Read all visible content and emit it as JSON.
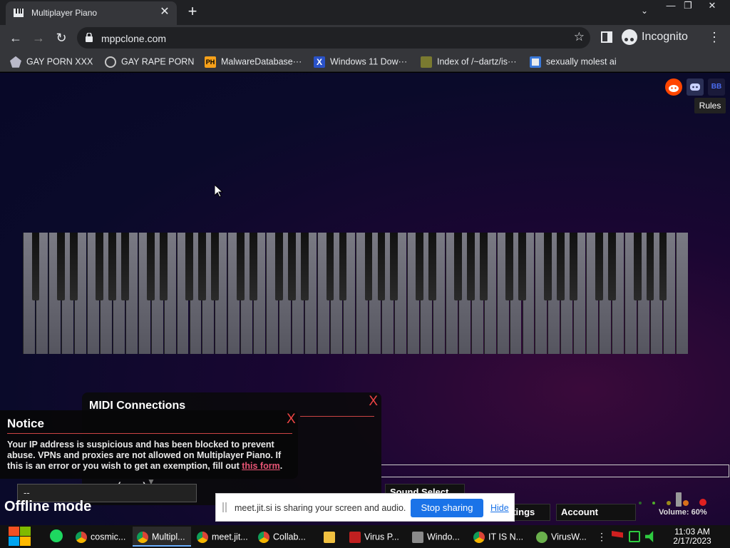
{
  "browser": {
    "tab_title": "Multiplayer Piano",
    "tab_close": "✕",
    "new_tab": "+",
    "tab_search": "⌄",
    "url": "mppclone.com",
    "incognito_label": "Incognito",
    "window": {
      "minimize": "—",
      "restore": "❐",
      "close": "✕"
    },
    "nav": {
      "back": "←",
      "forward": "→",
      "reload": "↻",
      "star": "☆",
      "menu": "⋮"
    }
  },
  "bookmarks": [
    {
      "label": "GAY PORN XXX",
      "icon": "obsidian-icon"
    },
    {
      "label": "GAY RAPE PORN",
      "icon": "globe-icon"
    },
    {
      "label": "MalwareDatabase···",
      "icon": "ph-icon"
    },
    {
      "label": "Windows 11 Dow···",
      "icon": "x-icon"
    },
    {
      "label": "Index of /~dartz/is···",
      "icon": "folder-icon"
    },
    {
      "label": "sexually molest ai",
      "icon": "bot-icon"
    }
  ],
  "page": {
    "rules_label": "Rules",
    "social_icons": [
      "reddit-icon",
      "discord-icon",
      "bb-icon"
    ],
    "bb_label": "BB",
    "midi": {
      "title": "MIDI Connections",
      "close": "X",
      "selected": "(none)",
      "arrow": "▼"
    },
    "notice": {
      "title": "Notice",
      "close": "X",
      "body": "Your IP address is suspicious and has been blocked to prevent abuse. VPNs and proxies are not allowed on Multiplayer Piano. If this is an error or you wish to get an exemption, fill out ",
      "link_text": "this form",
      "body_end": "."
    },
    "room_select": "--",
    "offline_label": "Offline mode",
    "sound_select_label": "Sound Select",
    "settings_label": "Settings",
    "account_label": "Account",
    "volume_label": "Volume: 60%",
    "volume": 0.6,
    "piano": {
      "white_keys": 52
    }
  },
  "share_bar": {
    "text": "meet.jit.si is sharing your screen and audio.",
    "stop_label": "Stop sharing",
    "hide_label": "Hide"
  },
  "taskbar": {
    "items": [
      {
        "label": "cosmic...",
        "icon": "chrome-icon",
        "active": false
      },
      {
        "label": "Multipl...",
        "icon": "chrome-icon",
        "active": true
      },
      {
        "label": "meet.jit...",
        "icon": "chrome-icon",
        "active": false
      },
      {
        "label": "Collab...",
        "icon": "chrome-icon",
        "active": false
      },
      {
        "label": "",
        "icon": "file-explorer-icon",
        "active": false
      },
      {
        "label": "Virus P...",
        "icon": "virus-icon",
        "active": false
      },
      {
        "label": "Windo...",
        "icon": "window-icon",
        "active": false
      },
      {
        "label": "IT IS N...",
        "icon": "chrome-icon",
        "active": false
      },
      {
        "label": "VirusW...",
        "icon": "virusw-icon",
        "active": false
      }
    ],
    "time": "11:03 AM",
    "date": "2/17/2023"
  },
  "colors": {
    "accent": "#1a73e8",
    "notice_link": "#e85575",
    "close_red": "#e44444"
  }
}
